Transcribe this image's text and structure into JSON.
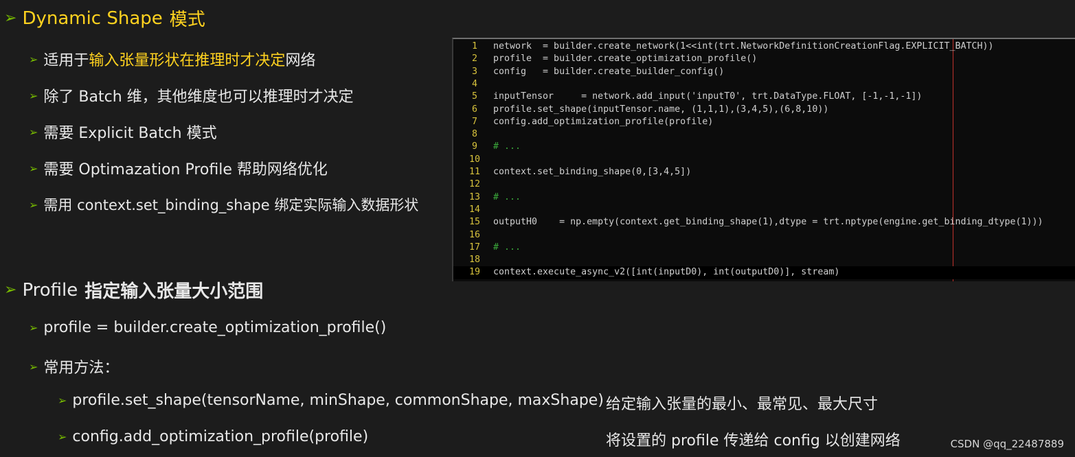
{
  "dynamic_shape": {
    "title_a": "Dynamic Shape",
    "title_b": "模式",
    "bullets": {
      "b1_pre": "适用于",
      "b1_hl": "输入张量形状在推理时才决定",
      "b1_post": "网络",
      "b2": "除了 Batch 维，其他维度也可以推理时才决定",
      "b3": "需要 Explicit Batch 模式",
      "b4": "需要 Optimazation Profile 帮助网络优化",
      "b5": "需用 context.set_binding_shape 绑定实际输入数据形状"
    }
  },
  "profile_section": {
    "title_a": "Profile",
    "title_b": "指定输入张量大小范围",
    "p1": "profile = builder.create_optimization_profile()",
    "p2": "常用方法：",
    "methods": [
      {
        "code": "profile.set_shape(tensorName, minShape, commonShape, maxShape)",
        "desc": "给定输入张量的最小、最常见、最大尺寸"
      },
      {
        "code": "config.add_optimization_profile(profile)",
        "desc": "将设置的 profile 传递给 config 以创建网络"
      }
    ]
  },
  "code": {
    "lines": [
      {
        "n": "1",
        "text": "network  = builder.create_network(1<<int(trt.NetworkDefinitionCreationFlag.EXPLICIT_BATCH))"
      },
      {
        "n": "2",
        "text": "profile  = builder.create_optimization_profile()"
      },
      {
        "n": "3",
        "text": "config   = builder.create_builder_config()"
      },
      {
        "n": "4",
        "text": ""
      },
      {
        "n": "5",
        "text": "inputTensor     = network.add_input('inputT0', trt.DataType.FLOAT, [-1,-1,-1])"
      },
      {
        "n": "6",
        "text": "profile.set_shape(inputTensor.name, (1,1,1),(3,4,5),(6,8,10))"
      },
      {
        "n": "7",
        "text": "config.add_optimization_profile(profile)"
      },
      {
        "n": "8",
        "text": ""
      },
      {
        "n": "9",
        "text": "# ..."
      },
      {
        "n": "10",
        "text": ""
      },
      {
        "n": "11",
        "text": "context.set_binding_shape(0,[3,4,5])"
      },
      {
        "n": "12",
        "text": ""
      },
      {
        "n": "13",
        "text": "# ..."
      },
      {
        "n": "14",
        "text": ""
      },
      {
        "n": "15",
        "text": "outputH0    = np.empty(context.get_binding_shape(1),dtype = trt.nptype(engine.get_binding_dtype(1)))"
      },
      {
        "n": "16",
        "text": ""
      },
      {
        "n": "17",
        "text": "# ..."
      },
      {
        "n": "18",
        "text": ""
      },
      {
        "n": "19",
        "text": "context.execute_async_v2([int(inputD0), int(outputD0)], stream)"
      }
    ]
  },
  "watermark": "CSDN @qq_22487889",
  "colors": {
    "arrow": "#76b900",
    "highlight": "#ffd21f",
    "code_bg": "#0c0c0c",
    "line_number": "#d7c23c",
    "comment": "#3aa83a",
    "guide_line": "#c0322b"
  }
}
